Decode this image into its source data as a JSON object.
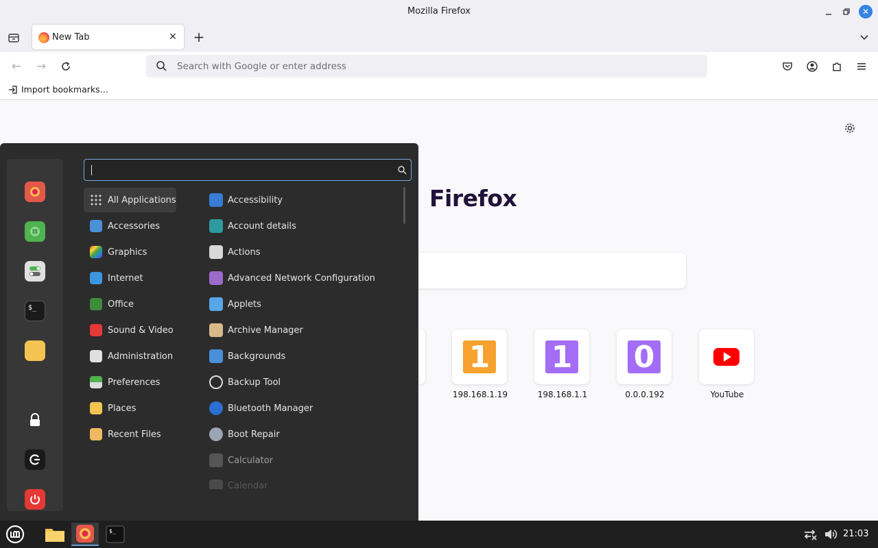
{
  "window": {
    "title": "Mozilla Firefox"
  },
  "tabs": [
    {
      "label": "New Tab"
    }
  ],
  "navbar": {
    "url_placeholder": "Search with Google or enter address"
  },
  "bookmarks": {
    "import_label": "Import bookmarks…"
  },
  "newtab_page": {
    "brand": "Firefox",
    "shortcuts": [
      {
        "label": "198.168.1.19",
        "icon_text": "1",
        "color": "#f7a12e"
      },
      {
        "label": "198.168.1.1",
        "icon_text": "1",
        "color": "#a36ef5"
      },
      {
        "label": "0.0.0.192",
        "icon_text": "0",
        "color": "#a36ef5"
      },
      {
        "label": "YouTube",
        "icon": "youtube-icon",
        "color": "#ff0000"
      }
    ]
  },
  "start_menu": {
    "categories": [
      {
        "label": "All Applications",
        "icon": "grid-icon",
        "active": true
      },
      {
        "label": "Accessories",
        "icon": "accessories-icon"
      },
      {
        "label": "Graphics",
        "icon": "graphics-icon"
      },
      {
        "label": "Internet",
        "icon": "cloud-icon"
      },
      {
        "label": "Office",
        "icon": "office-icon"
      },
      {
        "label": "Sound & Video",
        "icon": "play-icon"
      },
      {
        "label": "Administration",
        "icon": "admin-icon"
      },
      {
        "label": "Preferences",
        "icon": "preferences-icon"
      },
      {
        "label": "Places",
        "icon": "folder-icon"
      },
      {
        "label": "Recent Files",
        "icon": "recent-folder-icon"
      }
    ],
    "apps": [
      {
        "label": "Accessibility",
        "icon": "accessibility-icon"
      },
      {
        "label": "Account details",
        "icon": "account-icon"
      },
      {
        "label": "Actions",
        "icon": "actions-icon"
      },
      {
        "label": "Advanced Network Configuration",
        "icon": "network-icon"
      },
      {
        "label": "Applets",
        "icon": "applets-icon"
      },
      {
        "label": "Archive Manager",
        "icon": "archive-icon"
      },
      {
        "label": "Backgrounds",
        "icon": "backgrounds-icon"
      },
      {
        "label": "Backup Tool",
        "icon": "backup-icon"
      },
      {
        "label": "Bluetooth Manager",
        "icon": "bluetooth-icon"
      },
      {
        "label": "Boot Repair",
        "icon": "boot-repair-icon"
      },
      {
        "label": "Calculator",
        "icon": "calculator-icon"
      },
      {
        "label": "Calendar",
        "icon": "calendar-icon"
      }
    ],
    "favorites": [
      "firefox-icon",
      "spreadsheet-icon",
      "settings-toggle-icon",
      "terminal-icon",
      "folder-icon",
      "lock-icon",
      "logout-icon",
      "power-icon"
    ]
  },
  "taskbar": {
    "clock": "21:03"
  }
}
